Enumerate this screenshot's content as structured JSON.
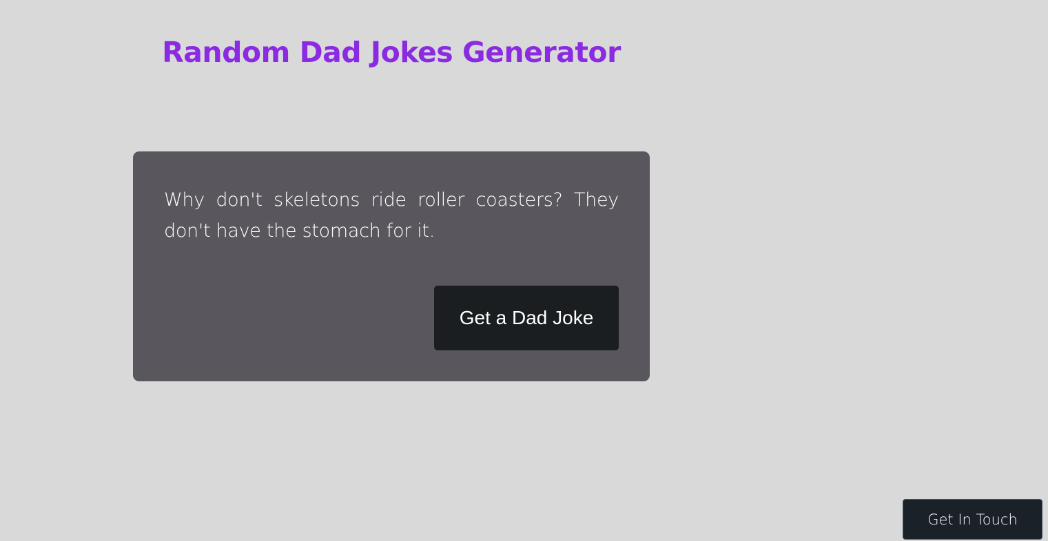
{
  "page": {
    "title": "Random Dad Jokes Generator"
  },
  "joke_card": {
    "text": "Why don't skeletons ride roller coasters? They don't have the stomach for it.",
    "button_label": "Get a Dad Joke"
  },
  "contact": {
    "button_label": "Get In Touch"
  },
  "colors": {
    "background": "#d9d9d9",
    "title": "#8a2be2",
    "card": "#59565d",
    "button": "#1b1e20",
    "contact_button": "#1a2128"
  }
}
